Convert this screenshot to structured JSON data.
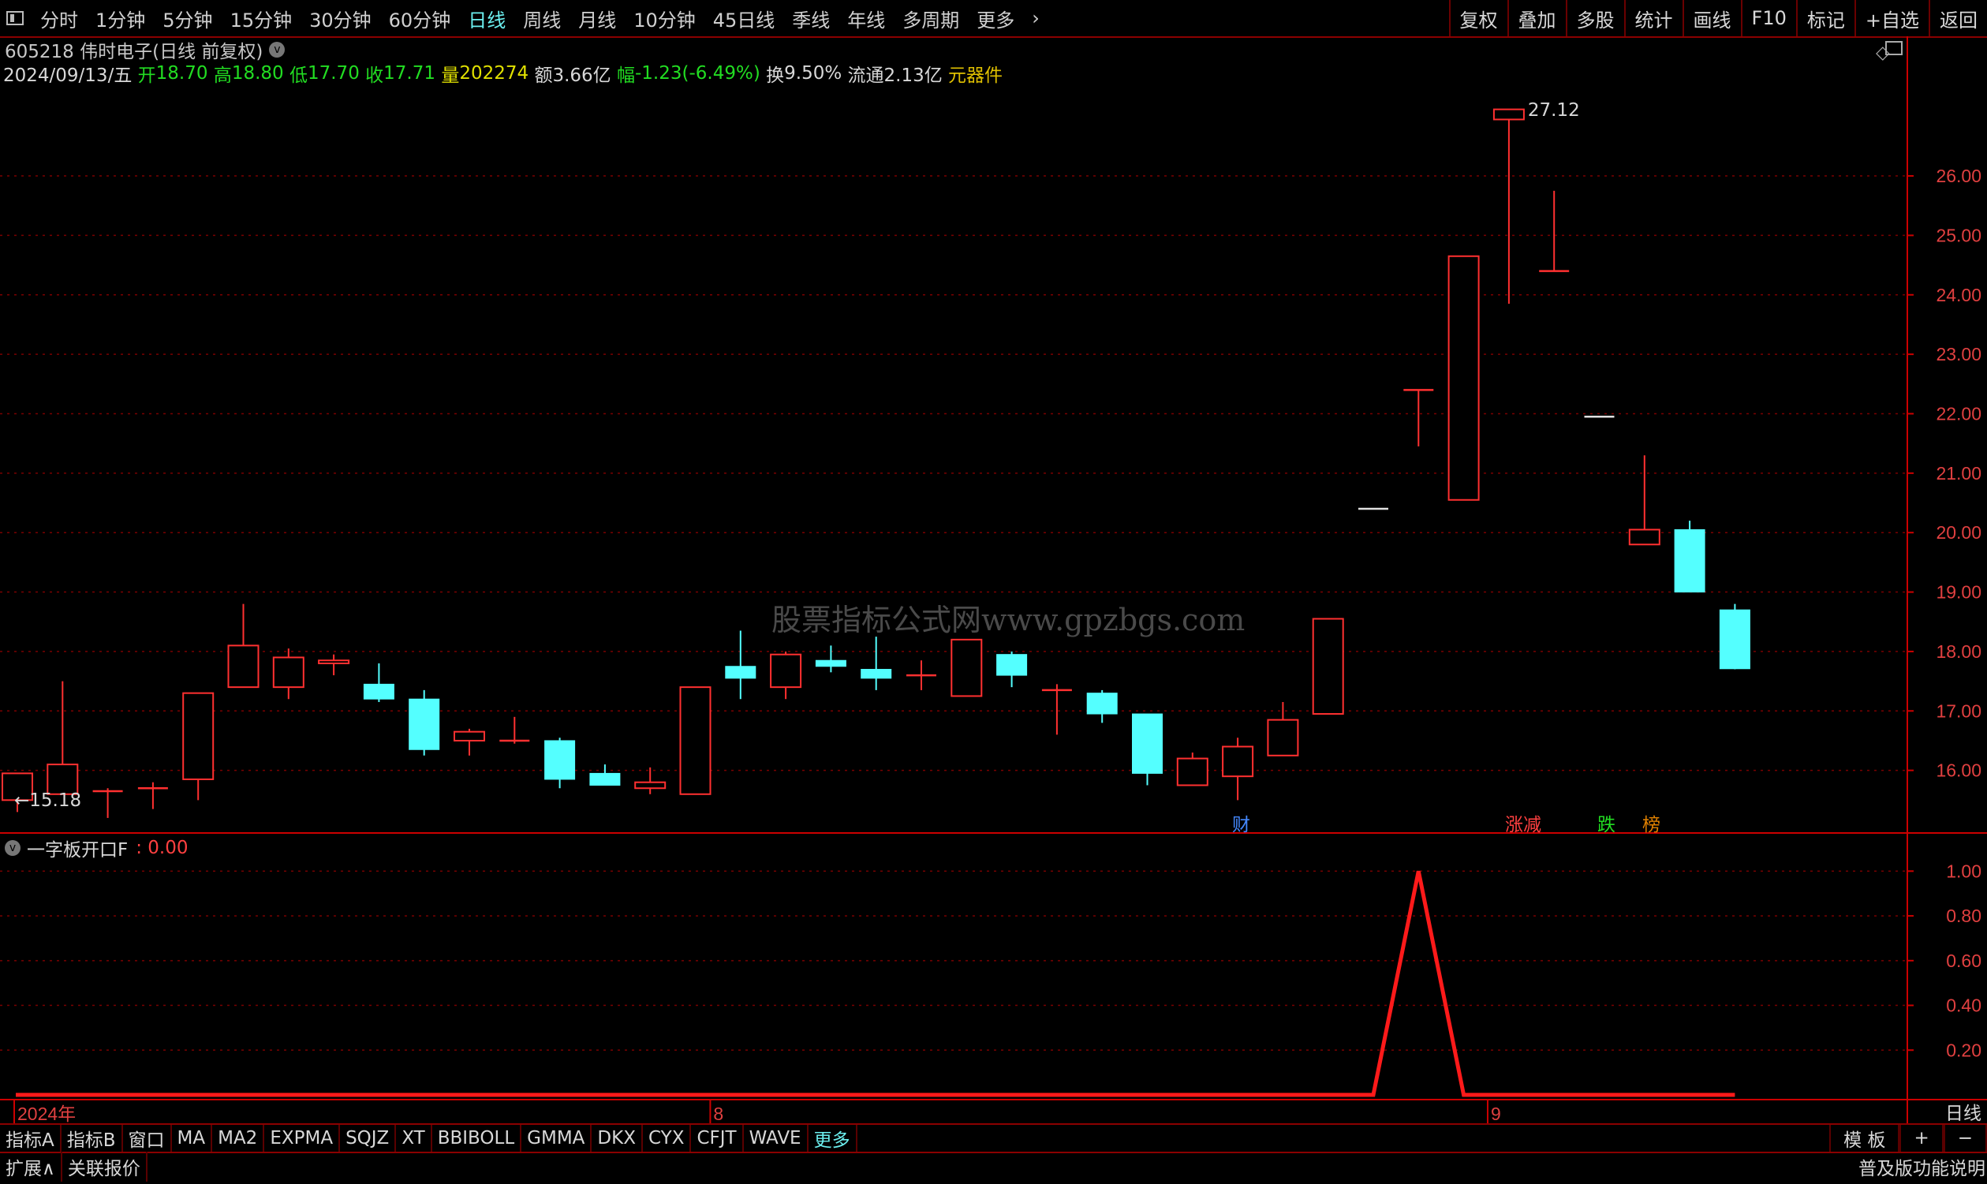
{
  "toolbar": {
    "periods": [
      "分时",
      "1分钟",
      "5分钟",
      "15分钟",
      "30分钟",
      "60分钟",
      "日线",
      "周线",
      "月线",
      "10分钟",
      "45日线",
      "季线",
      "年线",
      "多周期",
      "更多"
    ],
    "active_period": "日线",
    "right_buttons": [
      "复权",
      "叠加",
      "多股",
      "统计",
      "画线",
      "F10",
      "标记",
      "+自选",
      "返回"
    ]
  },
  "stock": {
    "title": "605218 伟时电子(日线 前复权)",
    "date": "2024/09/13/五",
    "open_label": "开",
    "open": "18.70",
    "high_label": "高",
    "high": "18.80",
    "low_label": "低",
    "low": "17.70",
    "close_label": "收",
    "close": "17.71",
    "volume_label": "量",
    "volume": "202274",
    "amount_label": "额",
    "amount": "3.66亿",
    "change_label": "幅",
    "change": "-1.23(-6.49%)",
    "turnover_label": "换",
    "turnover": "9.50%",
    "float_label": "流通",
    "float": "2.13亿",
    "sector": "元器件"
  },
  "price_axis": {
    "ticks": [
      "26.00",
      "25.00",
      "24.00",
      "23.00",
      "22.00",
      "21.00",
      "20.00",
      "19.00",
      "18.00",
      "17.00",
      "16.00"
    ]
  },
  "annotations": {
    "high_label": "27.12",
    "low_label": "←15.18",
    "period_label": "日线"
  },
  "event_marks": [
    {
      "text": "财",
      "color": "#4488ff"
    },
    {
      "text": "涨减",
      "color": "#ff4040"
    },
    {
      "text": "跌",
      "color": "#22dd22"
    },
    {
      "text": "榜",
      "color": "#e08000"
    }
  ],
  "watermark": "股票指标公式网www.gpzbgs.com",
  "indicator": {
    "name": "一字板开口F",
    "value": "0.00",
    "ticks": [
      "1.00",
      "0.80",
      "0.60",
      "0.40",
      "0.20"
    ]
  },
  "time_axis": {
    "labels": [
      "2024年",
      "8",
      "9"
    ]
  },
  "chart_data": [
    {
      "type": "candlestick",
      "title": "605218 伟时电子(日线 前复权)",
      "ylim": [
        15.0,
        27.5
      ],
      "candles": [
        {
          "o": 15.5,
          "c": 15.95,
          "h": 15.95,
          "l": 15.3
        },
        {
          "o": 15.6,
          "c": 16.1,
          "h": 17.5,
          "l": 15.6
        },
        {
          "o": 15.65,
          "c": 15.65,
          "h": 15.7,
          "l": 15.2
        },
        {
          "o": 15.7,
          "c": 15.7,
          "h": 15.8,
          "l": 15.35
        },
        {
          "o": 15.85,
          "c": 17.3,
          "h": 17.3,
          "l": 15.5
        },
        {
          "o": 17.4,
          "c": 18.1,
          "h": 18.8,
          "l": 17.4
        },
        {
          "o": 17.4,
          "c": 17.9,
          "h": 18.05,
          "l": 17.2
        },
        {
          "o": 17.8,
          "c": 17.85,
          "h": 17.95,
          "l": 17.6
        },
        {
          "o": 17.45,
          "c": 17.2,
          "h": 17.8,
          "l": 17.15
        },
        {
          "o": 17.2,
          "c": 16.35,
          "h": 17.35,
          "l": 16.25
        },
        {
          "o": 16.5,
          "c": 16.65,
          "h": 16.7,
          "l": 16.25
        },
        {
          "o": 16.5,
          "c": 16.5,
          "h": 16.9,
          "l": 16.45
        },
        {
          "o": 16.5,
          "c": 15.85,
          "h": 16.55,
          "l": 15.7
        },
        {
          "o": 15.95,
          "c": 15.75,
          "h": 16.1,
          "l": 15.75
        },
        {
          "o": 15.7,
          "c": 15.8,
          "h": 16.05,
          "l": 15.6
        },
        {
          "o": 15.6,
          "c": 17.4,
          "h": 17.4,
          "l": 15.6
        },
        {
          "o": 17.75,
          "c": 17.55,
          "h": 18.35,
          "l": 17.2
        },
        {
          "o": 17.4,
          "c": 17.95,
          "h": 18.0,
          "l": 17.2
        },
        {
          "o": 17.85,
          "c": 17.75,
          "h": 18.1,
          "l": 17.65
        },
        {
          "o": 17.7,
          "c": 17.55,
          "h": 18.25,
          "l": 17.35
        },
        {
          "o": 17.6,
          "c": 17.6,
          "h": 17.85,
          "l": 17.35
        },
        {
          "o": 17.25,
          "c": 18.2,
          "h": 18.2,
          "l": 17.25
        },
        {
          "o": 17.95,
          "c": 17.6,
          "h": 18.0,
          "l": 17.4
        },
        {
          "o": 17.35,
          "c": 17.35,
          "h": 17.45,
          "l": 16.6
        },
        {
          "o": 17.3,
          "c": 16.95,
          "h": 17.35,
          "l": 16.8
        },
        {
          "o": 16.95,
          "c": 15.95,
          "h": 16.95,
          "l": 15.75
        },
        {
          "o": 15.75,
          "c": 16.2,
          "h": 16.3,
          "l": 15.75
        },
        {
          "o": 15.9,
          "c": 16.4,
          "h": 16.55,
          "l": 15.5
        },
        {
          "o": 16.25,
          "c": 16.85,
          "h": 17.15,
          "l": 16.25
        },
        {
          "o": 16.95,
          "c": 18.55,
          "h": 18.55,
          "l": 16.95
        },
        {
          "o": 20.4,
          "c": 20.4,
          "h": 20.4,
          "l": 20.4
        },
        {
          "o": 22.4,
          "c": 22.4,
          "h": 22.4,
          "l": 21.45
        },
        {
          "o": 20.55,
          "c": 24.65,
          "h": 24.65,
          "l": 20.55
        },
        {
          "o": 26.95,
          "c": 27.12,
          "h": 27.12,
          "l": 23.85
        },
        {
          "o": 24.4,
          "c": 24.4,
          "h": 25.75,
          "l": 24.4
        },
        {
          "o": 21.95,
          "c": 21.95,
          "h": 21.95,
          "l": 21.95
        },
        {
          "o": 19.8,
          "c": 20.05,
          "h": 21.3,
          "l": 19.8
        },
        {
          "o": 20.05,
          "c": 19.0,
          "h": 20.2,
          "l": 19.0
        },
        {
          "o": 18.7,
          "c": 17.71,
          "h": 18.8,
          "l": 17.7
        }
      ]
    },
    {
      "type": "line",
      "title": "一字板开口F",
      "ylim": [
        0,
        1.1
      ],
      "series": [
        {
          "name": "一字板开口F",
          "values": [
            0,
            0,
            0,
            0,
            0,
            0,
            0,
            0,
            0,
            0,
            0,
            0,
            0,
            0,
            0,
            0,
            0,
            0,
            0,
            0,
            0,
            0,
            0,
            0,
            0,
            0,
            0,
            0,
            0,
            0,
            0,
            1,
            0,
            0,
            0,
            0,
            0,
            0,
            0
          ]
        }
      ]
    }
  ],
  "indicator_tabs": [
    "指标A",
    "指标B",
    "窗口",
    "MA",
    "MA2",
    "EXPMA",
    "SQJZ",
    "XT",
    "BBIBOLL",
    "GMMA",
    "DKX",
    "CYX",
    "CFJT",
    "WAVE",
    "更多"
  ],
  "bottom_right": [
    "模 板",
    "+",
    "−"
  ],
  "status_bar": {
    "left": [
      "扩展∧",
      "关联报价"
    ],
    "right": "普及版功能说明"
  },
  "colors": {
    "up": "#ff3030",
    "down": "#54ffff",
    "grid": "#7a0000",
    "axis": "#cc0000",
    "accent_active": "#6cf0f0"
  }
}
